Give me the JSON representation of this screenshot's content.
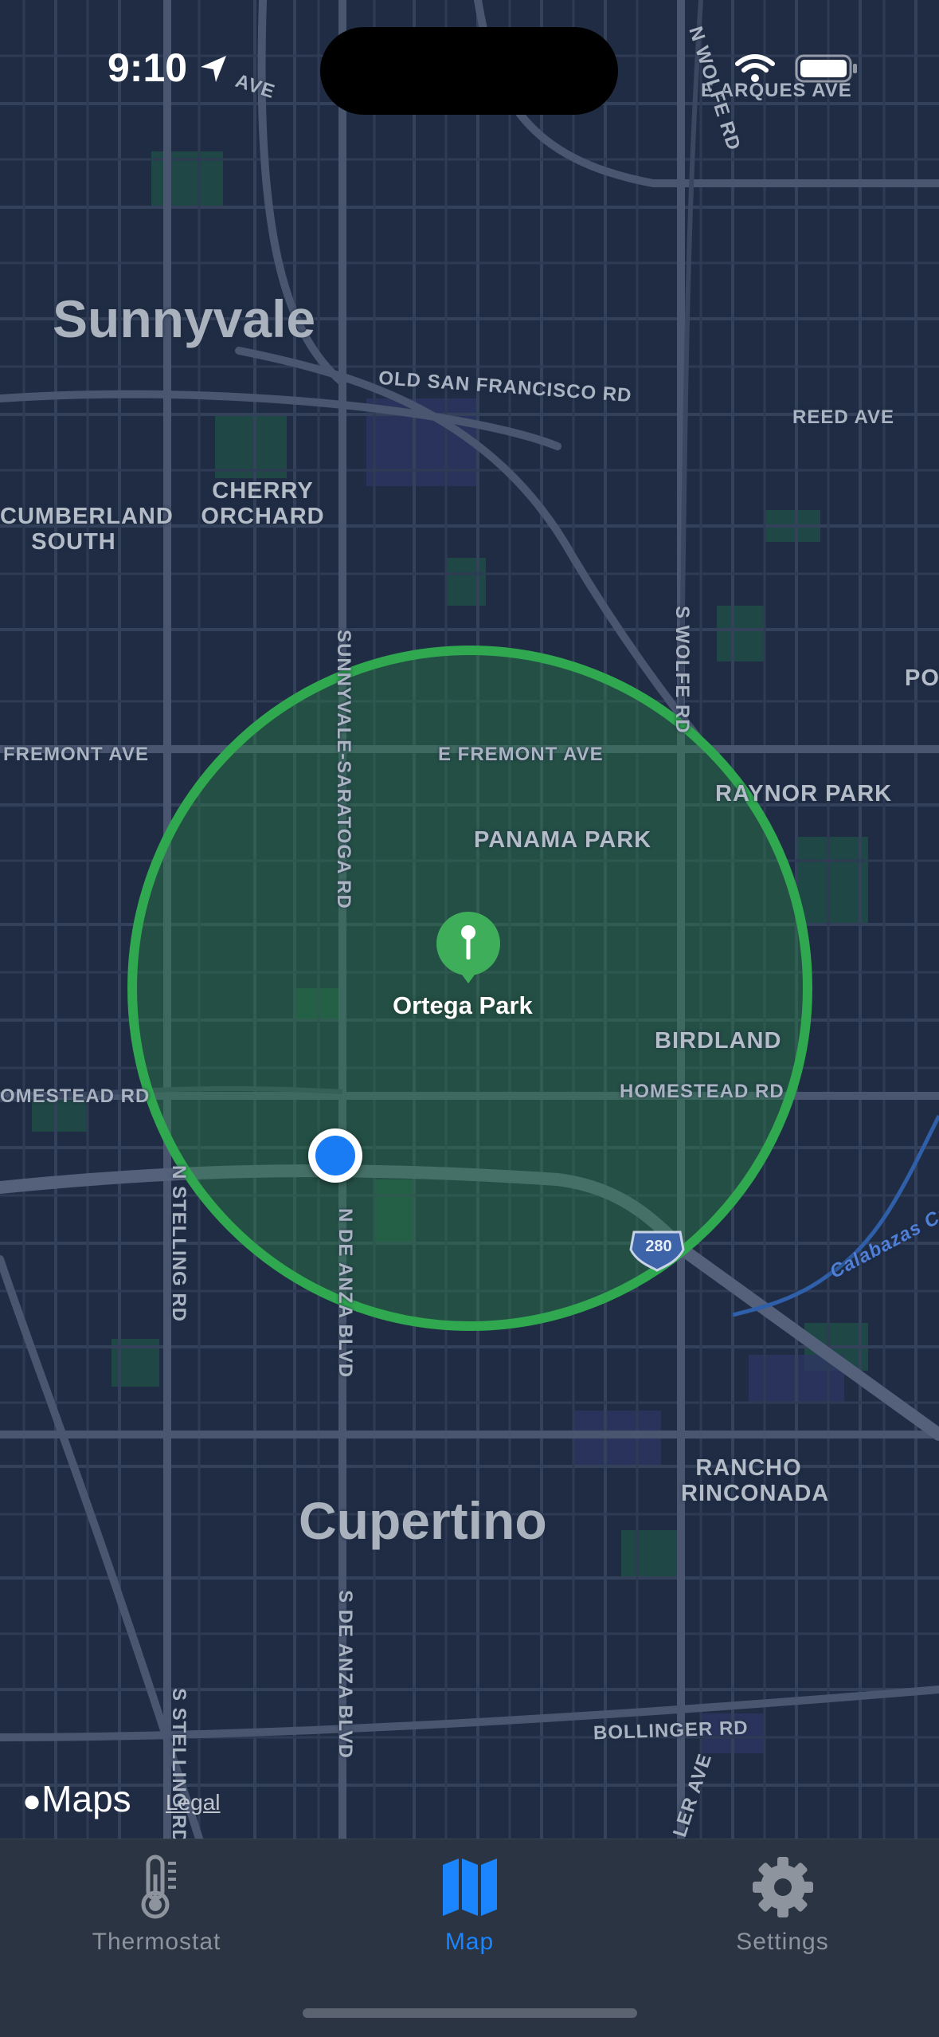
{
  "status_bar": {
    "time": "9:10"
  },
  "map": {
    "city_labels": [
      "Sunnyvale",
      "Cupertino"
    ],
    "neighborhoods": {
      "cherry_orchard": [
        "CHERRY",
        "ORCHARD"
      ],
      "cumberland_south": [
        "CUMBERLAND",
        "SOUTH"
      ],
      "panama_park": "PANAMA PARK",
      "raynor_park": "RAYNOR PARK",
      "birdland": "BIRDLAND",
      "rancho_rinconada": [
        "RANCHO",
        "RINCONADA"
      ],
      "edge_label": "POI"
    },
    "roads": {
      "e_arques_ave": "E ARQUES AVE",
      "n_wolfe_rd": "N WOLFE RD",
      "ave_top": "AVE",
      "old_san_francisco_rd": "OLD SAN FRANCISCO RD",
      "reed_ave": "REED AVE",
      "fremont_ave_w": "FREMONT AVE",
      "e_fremont_ave": "E FREMONT AVE",
      "sunnyvale_saratoga_rd": "SUNNYVALE-SARATOGA RD",
      "s_wolfe_rd": "S WOLFE RD",
      "homestead_rd_w": "OMESTEAD RD",
      "homestead_rd_e": "HOMESTEAD RD",
      "n_stelling_rd": "N STELLING RD",
      "n_de_anza_blvd": "N DE ANZA BLVD",
      "s_de_anza_blvd": "S DE ANZA BLVD",
      "s_stelling_rd": "S STELLING RD",
      "bollinger_rd": "BOLLINGER RD",
      "ler_ave": "LER AVE",
      "highway_280": "280",
      "calabazas_creek": "Calabazas Creek"
    },
    "pin": {
      "label": "Ortega Park",
      "color": "#3fae5a"
    },
    "geofence_color": "#2fa84f",
    "user_location_color": "#1a7cf5",
    "attribution": {
      "logo": "Maps",
      "legal": "Legal"
    }
  },
  "tab_bar": {
    "tabs": [
      {
        "label": "Thermostat",
        "icon": "thermometer-icon",
        "active": false
      },
      {
        "label": "Map",
        "icon": "map-icon",
        "active": true
      },
      {
        "label": "Settings",
        "icon": "gear-icon",
        "active": false
      }
    ],
    "active_color": "#1a85ff",
    "inactive_color": "#8e949e"
  }
}
